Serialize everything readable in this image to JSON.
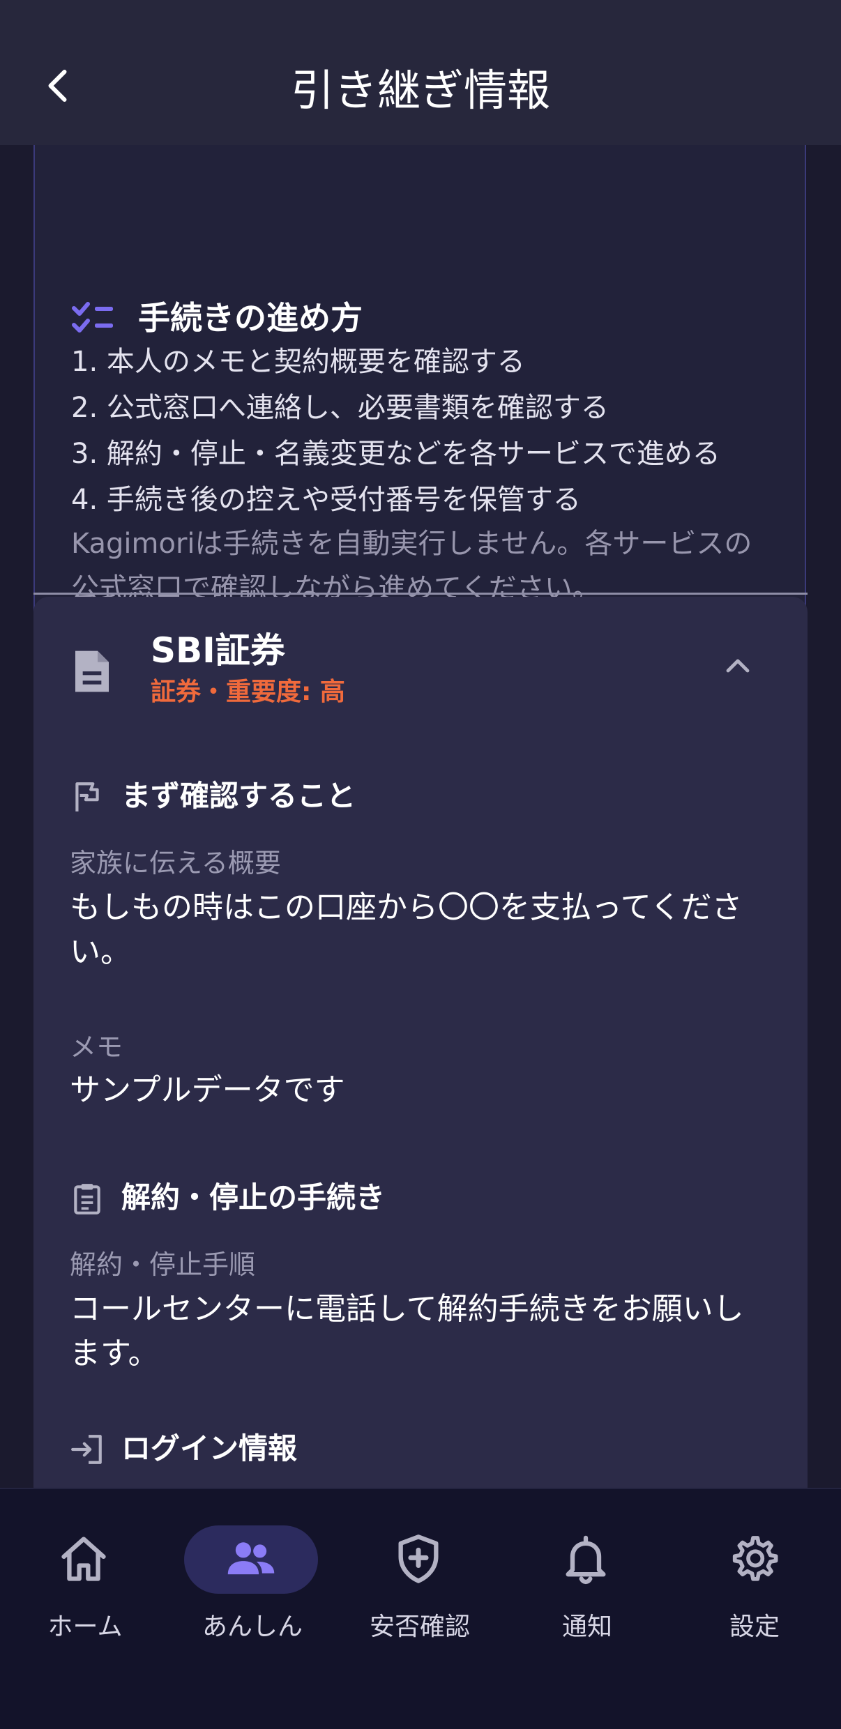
{
  "header": {
    "title": "引き継ぎ情報",
    "back_icon": "chevron-left-icon"
  },
  "steps_card": {
    "icon": "checklist-icon",
    "title": "手続きの進め方",
    "steps": [
      "1. 本人のメモと契約概要を確認する",
      "2. 公式窓口へ連絡し、必要書類を確認する",
      "3. 解約・停止・名義変更などを各サービスで進める",
      "4. 手続き後の控えや受付番号を保管する"
    ],
    "note": "Kagimoriは手続きを自動実行しません。各サービスの公式窓口で確認しながら進めてください。"
  },
  "account_card": {
    "icon": "document-icon",
    "name": "SBI証券",
    "subtitle": "証券・重要度: 高",
    "collapse_icon": "chevron-up-icon",
    "sections": {
      "first_check": {
        "icon": "flag-icon",
        "title": "まず確認すること",
        "summary_label": "家族に伝える概要",
        "summary_value": "もしもの時はこの口座から〇〇を支払ってください。",
        "memo_label": "メモ",
        "memo_value": "サンプルデータです"
      },
      "cancel": {
        "icon": "clipboard-icon",
        "title": "解約・停止の手続き",
        "procedure_label": "解約・停止手順",
        "procedure_value": "コールセンターに電話して解約手続きをお願いします。"
      },
      "login": {
        "icon": "login-icon",
        "title": "ログイン情報"
      }
    }
  },
  "bottom_nav": {
    "active": "あんしん",
    "items": [
      {
        "label": "ホーム",
        "icon": "home-icon"
      },
      {
        "label": "あんしん",
        "icon": "people-icon"
      },
      {
        "label": "安否確認",
        "icon": "shield-plus-icon"
      },
      {
        "label": "通知",
        "icon": "bell-icon"
      },
      {
        "label": "設定",
        "icon": "gear-icon"
      }
    ]
  },
  "colors": {
    "accent": "#7b6cf0",
    "importance": "#f06a3c",
    "background": "#1b1a2e",
    "card": "#2c2b48"
  }
}
